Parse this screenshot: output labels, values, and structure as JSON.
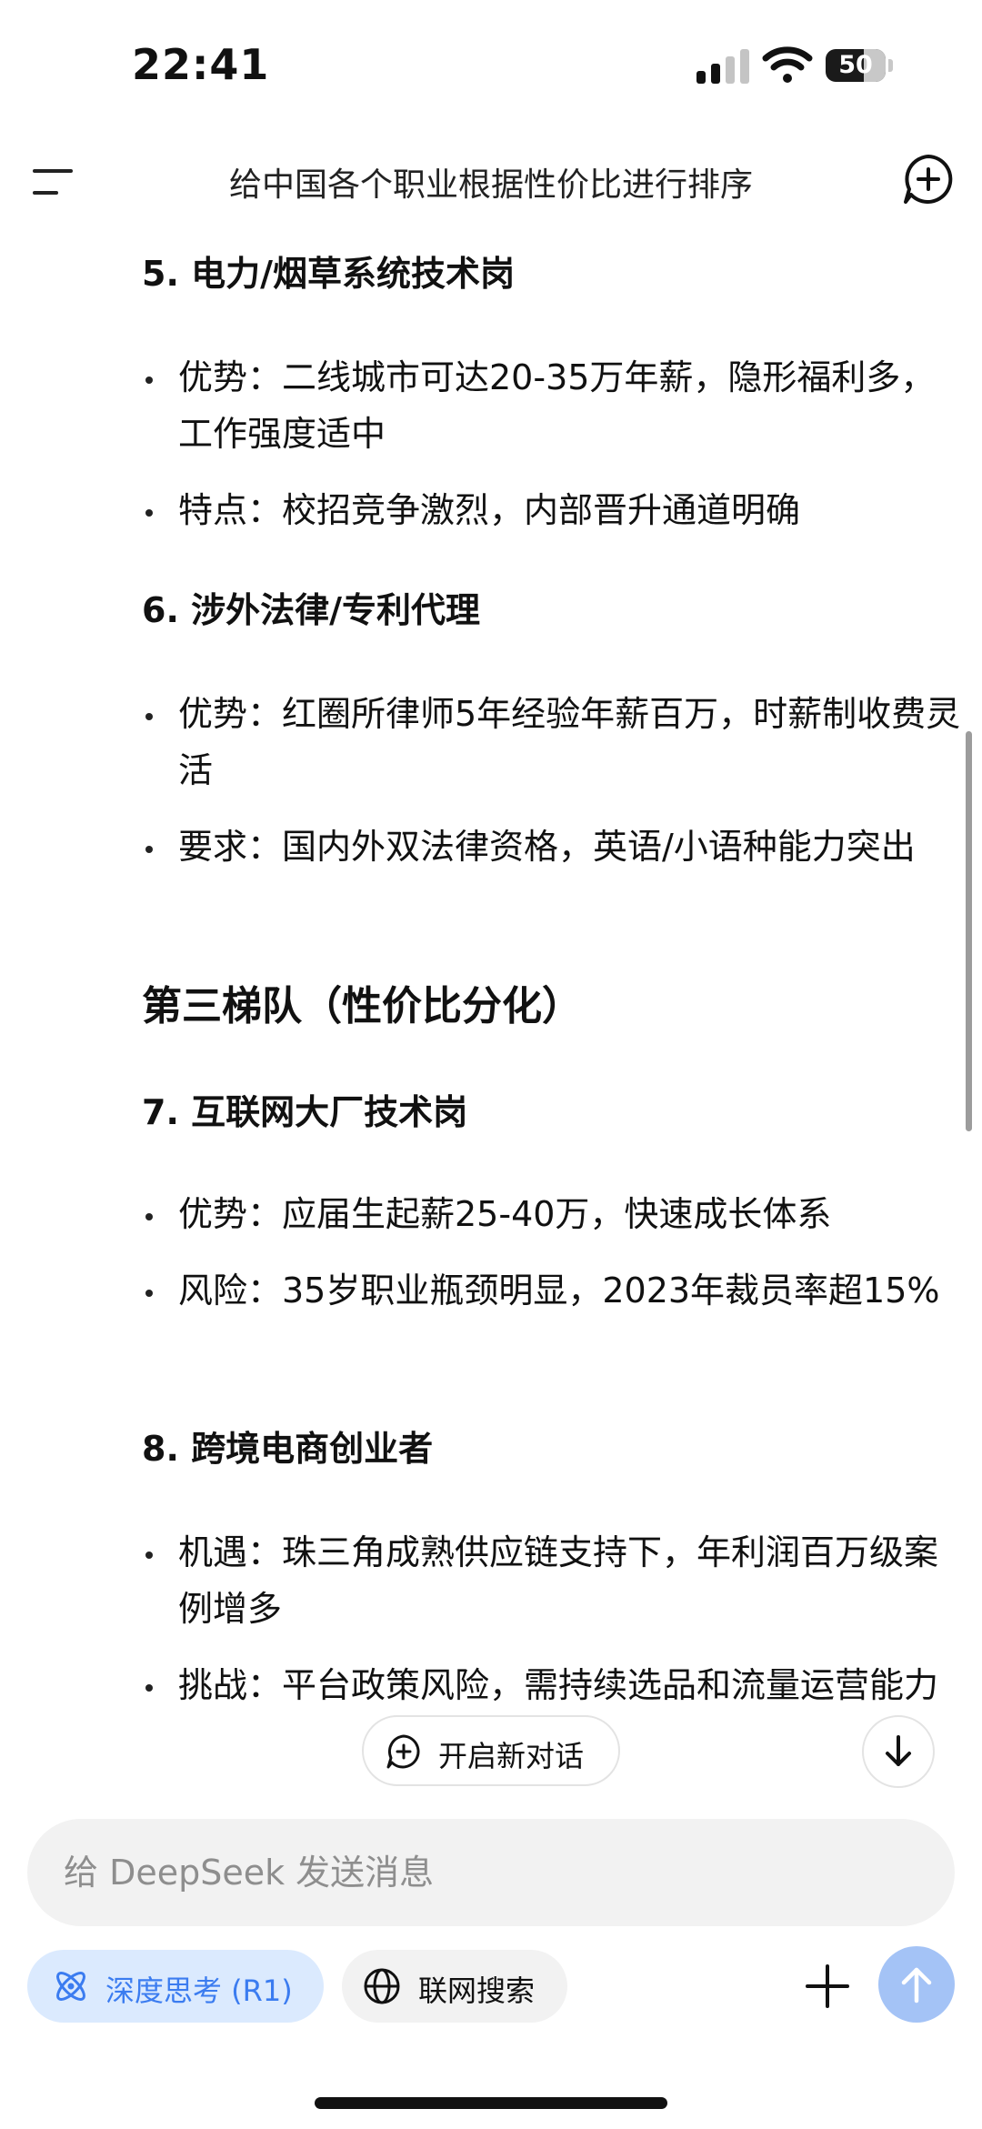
{
  "status_bar": {
    "time": "22:41",
    "battery_level": "50"
  },
  "header": {
    "title": "给中国各个职业根据性价比进行排序"
  },
  "content": {
    "section5": {
      "heading": "5. 电力/烟草系统技术岗",
      "bullets": [
        "优势：二线城市可达20-35万年薪，隐形福利多，工作强度适中",
        "特点：校招竞争激烈，内部晋升通道明确"
      ]
    },
    "section6": {
      "heading": "6. 涉外法律/专利代理",
      "bullets": [
        "优势：红圈所律师5年经验年薪百万，时薪制收费灵活",
        "要求：国内外双法律资格，英语/小语种能力突出"
      ]
    },
    "tier3": {
      "heading": "第三梯队（性价比分化）"
    },
    "section7": {
      "heading": "7. 互联网大厂技术岗",
      "bullets": [
        "优势：应届生起薪25-40万，快速成长体系",
        "风险：35岁职业瓶颈明显，2023年裁员率超15%"
      ]
    },
    "section8": {
      "heading": "8. 跨境电商创业者",
      "bullets": [
        "机遇：珠三角成熟供应链支持下，年利润百万级案例增多",
        "挑战：平台政策风险，需持续选品和流量运营能力"
      ]
    }
  },
  "floating": {
    "new_chat_label": "开启新对话"
  },
  "input": {
    "placeholder": "给 DeepSeek 发送消息"
  },
  "toolbar": {
    "deep_think_label": "深度思考 (R1)",
    "web_search_label": "联网搜索"
  },
  "colors": {
    "accent": "#3b7cf0",
    "accent_bg": "#dbeafe",
    "send_bg": "#a4c3f6"
  }
}
